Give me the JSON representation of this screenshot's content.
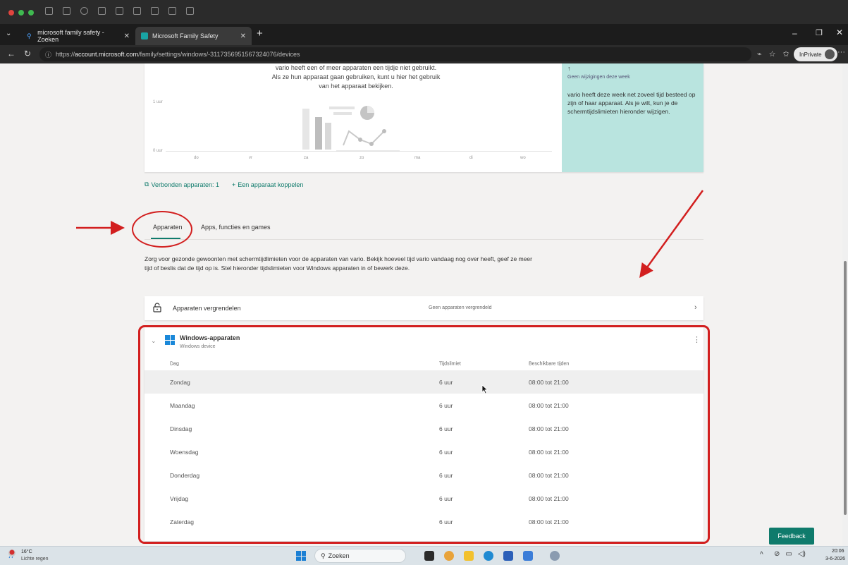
{
  "browser": {
    "tabs": [
      {
        "title": "microsoft family safety - Zoeken"
      },
      {
        "title": "Microsoft Family Safety"
      }
    ],
    "url_prefix": "https://",
    "url_host": "account.microsoft.com",
    "url_path": "/family/settings/windows/-3117356951567324076/devices",
    "inprivate_label": "InPrivate"
  },
  "chart": {
    "empty_message": "vario heeft een of meer apparaten een tijdje niet gebruikt. Als ze hun apparaat gaan gebruiken, kunt u hier het gebruik van het apparaat bekijken.",
    "y_top_label": "1 uur",
    "y_bottom_label": "0 uur",
    "x_labels": [
      "do",
      "vr",
      "za",
      "zo",
      "ma",
      "di",
      "wo"
    ]
  },
  "insight": {
    "arrow": "↑",
    "week_status": "Geen wijzigingen deze week",
    "text": "vario heeft deze week net zoveel tijd besteed op zijn of haar apparaat. Als je wilt, kun je de schermtijdslimieten hieronder wijzigen."
  },
  "connected": {
    "count_label": "Verbonden apparaten: 1",
    "link_label": "Een apparaat koppelen"
  },
  "tabs": {
    "devices": "Apparaten",
    "apps": "Apps, functies en games"
  },
  "description": "Zorg voor gezonde gewoonten met schermtijdlimieten voor de apparaten van vario. Bekijk hoeveel tijd vario vandaag nog over heeft, geef ze meer tijd of beslis dat de tijd op is. Stel hieronder tijdslimieten voor Windows apparaten in of bewerk deze.",
  "lock_devices": {
    "title": "Apparaten vergrendelen",
    "status": "Geen apparaten vergrendeld"
  },
  "windows_devices": {
    "title": "Windows-apparaten",
    "subtitle": "Windows device",
    "columns": [
      "Dag",
      "Tijdslimiet",
      "Beschikbare tijden"
    ],
    "rows": [
      {
        "day": "Zondag",
        "limit": "6 uur",
        "times": "08:00 tot 21:00"
      },
      {
        "day": "Maandag",
        "limit": "6 uur",
        "times": "08:00 tot 21:00"
      },
      {
        "day": "Dinsdag",
        "limit": "6 uur",
        "times": "08:00 tot 21:00"
      },
      {
        "day": "Woensdag",
        "limit": "6 uur",
        "times": "08:00 tot 21:00"
      },
      {
        "day": "Donderdag",
        "limit": "6 uur",
        "times": "08:00 tot 21:00"
      },
      {
        "day": "Vrijdag",
        "limit": "6 uur",
        "times": "08:00 tot 21:00"
      },
      {
        "day": "Zaterdag",
        "limit": "6 uur",
        "times": "08:00 tot 21:00"
      }
    ]
  },
  "feedback_label": "Feedback",
  "taskbar": {
    "weather_temp": "16°C",
    "weather_desc": "Lichte regen",
    "search_placeholder": "Zoeken",
    "time": "20:06",
    "date": "3-6-2026"
  },
  "colors": {
    "accent": "#0f7b6c",
    "insight_bg": "#b9e4df",
    "annotation_red": "#d21f1f"
  }
}
